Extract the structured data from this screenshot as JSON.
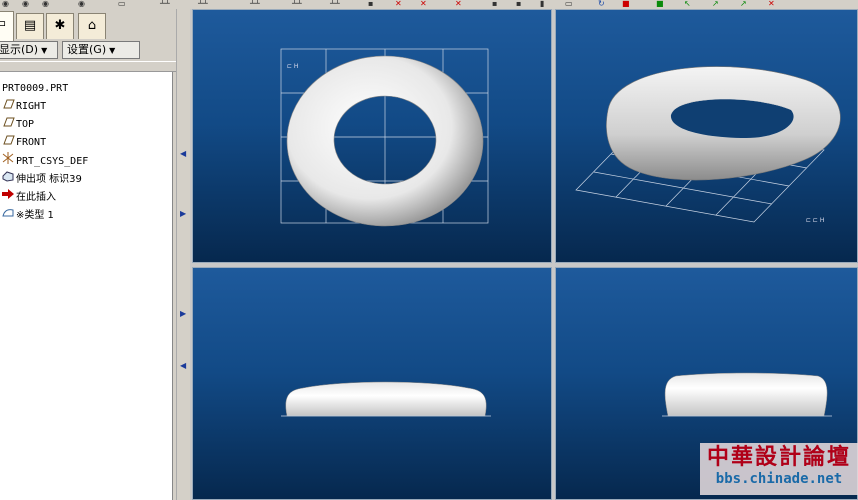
{
  "menu": {
    "display_label": "显示(D)",
    "settings_label": "设置(G)"
  },
  "tree": {
    "root": "PRT0009.PRT",
    "items": [
      {
        "label": "RIGHT",
        "icon": "datum-plane-icon"
      },
      {
        "label": "TOP",
        "icon": "datum-plane-icon"
      },
      {
        "label": "FRONT",
        "icon": "datum-plane-icon"
      },
      {
        "label": "PRT_CSYS_DEF",
        "icon": "coordinate-system-icon"
      },
      {
        "label": "伸出项 标识39",
        "icon": "protrusion-feature-icon"
      },
      {
        "label": "在此插入",
        "icon": "insert-here-arrow-icon"
      },
      {
        "label": "※类型 1",
        "icon": "variable-section-sweep-icon"
      }
    ]
  },
  "colors": {
    "viewport_top": "#1e5a9c",
    "viewport_bottom": "#06284e",
    "insert_arrow": "#c00000",
    "watermark_text": "#b00018",
    "watermark_url": "#1a6aa8"
  },
  "watermark": {
    "title": "中華設計論壇",
    "url": "bbs.chinade.net"
  }
}
